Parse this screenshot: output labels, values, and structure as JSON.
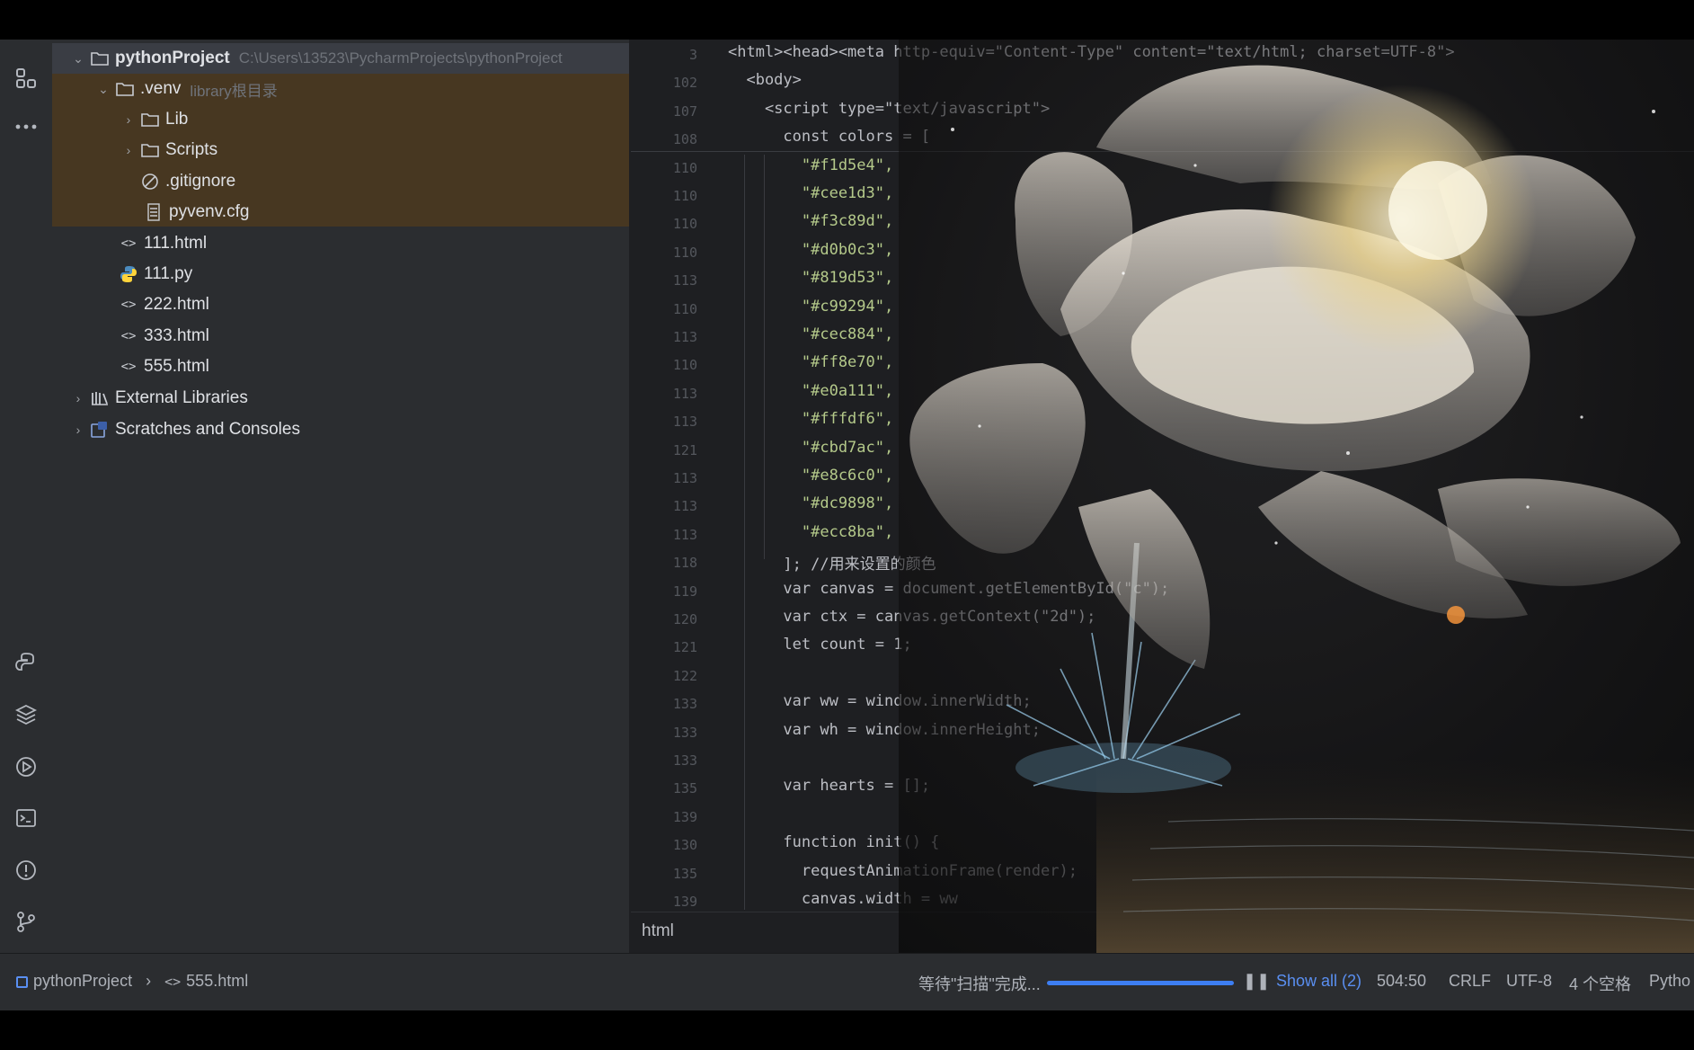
{
  "project": {
    "root_name": "pythonProject",
    "root_path": "C:\\Users\\13523\\PycharmProjects\\pythonProject",
    "venv_name": ".venv",
    "venv_hint": "library根目录",
    "lib": "Lib",
    "scripts": "Scripts",
    "gitignore": ".gitignore",
    "pyvenv": "pyvenv.cfg",
    "files": [
      "111.html",
      "111.py",
      "222.html",
      "333.html",
      "555.html"
    ],
    "external": "External Libraries",
    "scratches": "Scratches and Consoles"
  },
  "editor": {
    "line_numbers": [
      "3",
      "102",
      "107",
      "108",
      "110",
      "110",
      "110",
      "110",
      "113",
      "110",
      "113",
      "110",
      "113",
      "113",
      "121",
      "113",
      "113",
      "113",
      "118",
      "119",
      "120",
      "121",
      "122",
      "133",
      "133",
      "133",
      "135",
      "139",
      "130",
      "135",
      "139"
    ],
    "lines": [
      "<html><head><meta http-equiv=\"Content-Type\" content=\"text/html; charset=UTF-8\">",
      "  <body>",
      "    <script type=\"text/javascript\">",
      "      const colors = [",
      "        \"#f1d5e4\",",
      "        \"#cee1d3\",",
      "        \"#f3c89d\",",
      "        \"#d0b0c3\",",
      "        \"#819d53\",",
      "        \"#c99294\",",
      "        \"#cec884\",",
      "        \"#ff8e70\",",
      "        \"#e0a111\",",
      "        \"#fffdf6\",",
      "        \"#cbd7ac\",",
      "        \"#e8c6c0\",",
      "        \"#dc9898\",",
      "        \"#ecc8ba\",",
      "      ]; //用来设置的颜色",
      "      var canvas = document.getElementById(\"c\");",
      "      var ctx = canvas.getContext(\"2d\");",
      "      let count = 1;",
      "",
      "      var ww = window.innerWidth;",
      "      var wh = window.innerHeight;",
      "",
      "      var hearts = [];",
      "",
      "      function init() {",
      "        requestAnimationFrame(render);",
      "        canvas.width = ww"
    ],
    "breadcrumb": "html"
  },
  "statusbar": {
    "crumb_root": "pythonProject",
    "crumb_file": "555.html",
    "task": "等待\"扫描\"完成...",
    "show_all": "Show all (2)",
    "position": "504:50",
    "line_sep": "CRLF",
    "encoding": "UTF-8",
    "indent": "4 个空格",
    "lang": "Pytho",
    "progress": 0.85
  },
  "colors": {
    "accent": "#3d7ef2",
    "venv_bg": "#4a3920",
    "panel": "#2b2d30",
    "editor": "#1e1f22"
  }
}
